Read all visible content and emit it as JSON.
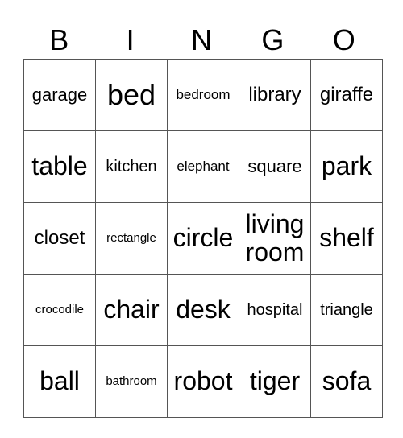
{
  "header": [
    "B",
    "I",
    "N",
    "G",
    "O"
  ],
  "rows": [
    [
      "garage",
      "bed",
      "bedroom",
      "library",
      "giraffe"
    ],
    [
      "table",
      "kitchen",
      "elephant",
      "square",
      "park"
    ],
    [
      "closet",
      "rectangle",
      "circle",
      "living room",
      "shelf"
    ],
    [
      "crocodile",
      "chair",
      "desk",
      "hospital",
      "triangle"
    ],
    [
      "ball",
      "bathroom",
      "robot",
      "tiger",
      "sofa"
    ]
  ]
}
